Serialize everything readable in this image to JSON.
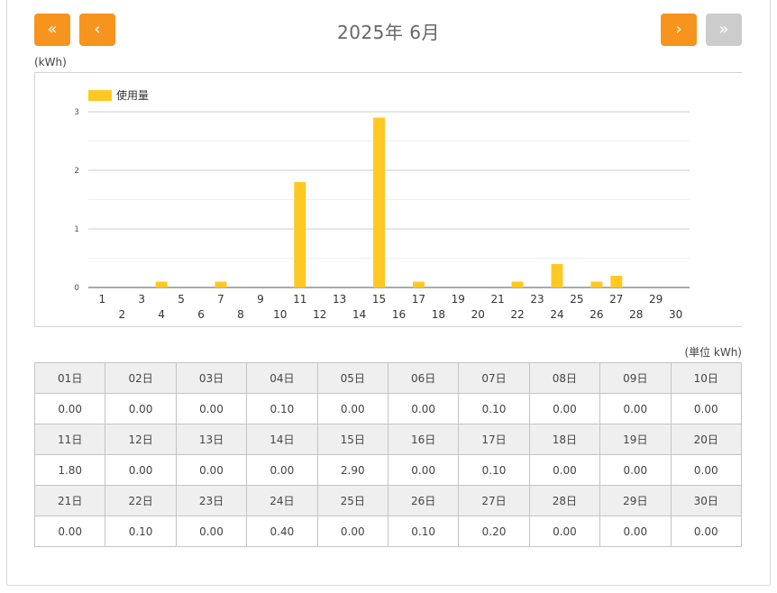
{
  "header": {
    "title": "2025年 6月",
    "first_label": "«",
    "prev_label": "‹",
    "next_label": "›",
    "last_label": "»"
  },
  "colors": {
    "accent": "#f7941d",
    "disabled": "#cccccc",
    "bar": "#ffc823"
  },
  "chart_unit": "(kWh)",
  "table_unit": "(単位 kWh)",
  "chart_data": {
    "type": "bar",
    "categories": [
      "1",
      "2",
      "3",
      "4",
      "5",
      "6",
      "7",
      "8",
      "9",
      "10",
      "11",
      "12",
      "13",
      "14",
      "15",
      "16",
      "17",
      "18",
      "19",
      "20",
      "21",
      "22",
      "23",
      "24",
      "25",
      "26",
      "27",
      "28",
      "29",
      "30"
    ],
    "series": [
      {
        "name": "使用量",
        "values": [
          0,
          0,
          0,
          0.1,
          0,
          0,
          0.1,
          0,
          0,
          0,
          1.8,
          0,
          0,
          0,
          2.9,
          0,
          0.1,
          0,
          0,
          0,
          0,
          0.1,
          0,
          0.4,
          0,
          0.1,
          0.2,
          0,
          0,
          0
        ]
      }
    ],
    "yticks": [
      "0",
      "1",
      "2",
      "3"
    ],
    "ylim": [
      0,
      3
    ],
    "grid": true,
    "legend": "top-left"
  },
  "table": {
    "rows": [
      {
        "days": [
          "01日",
          "02日",
          "03日",
          "04日",
          "05日",
          "06日",
          "07日",
          "08日",
          "09日",
          "10日"
        ],
        "values": [
          "0.00",
          "0.00",
          "0.00",
          "0.10",
          "0.00",
          "0.00",
          "0.10",
          "0.00",
          "0.00",
          "0.00"
        ]
      },
      {
        "days": [
          "11日",
          "12日",
          "13日",
          "14日",
          "15日",
          "16日",
          "17日",
          "18日",
          "19日",
          "20日"
        ],
        "values": [
          "1.80",
          "0.00",
          "0.00",
          "0.00",
          "2.90",
          "0.00",
          "0.10",
          "0.00",
          "0.00",
          "0.00"
        ]
      },
      {
        "days": [
          "21日",
          "22日",
          "23日",
          "24日",
          "25日",
          "26日",
          "27日",
          "28日",
          "29日",
          "30日"
        ],
        "values": [
          "0.00",
          "0.10",
          "0.00",
          "0.40",
          "0.00",
          "0.10",
          "0.20",
          "0.00",
          "0.00",
          "0.00"
        ]
      }
    ]
  }
}
